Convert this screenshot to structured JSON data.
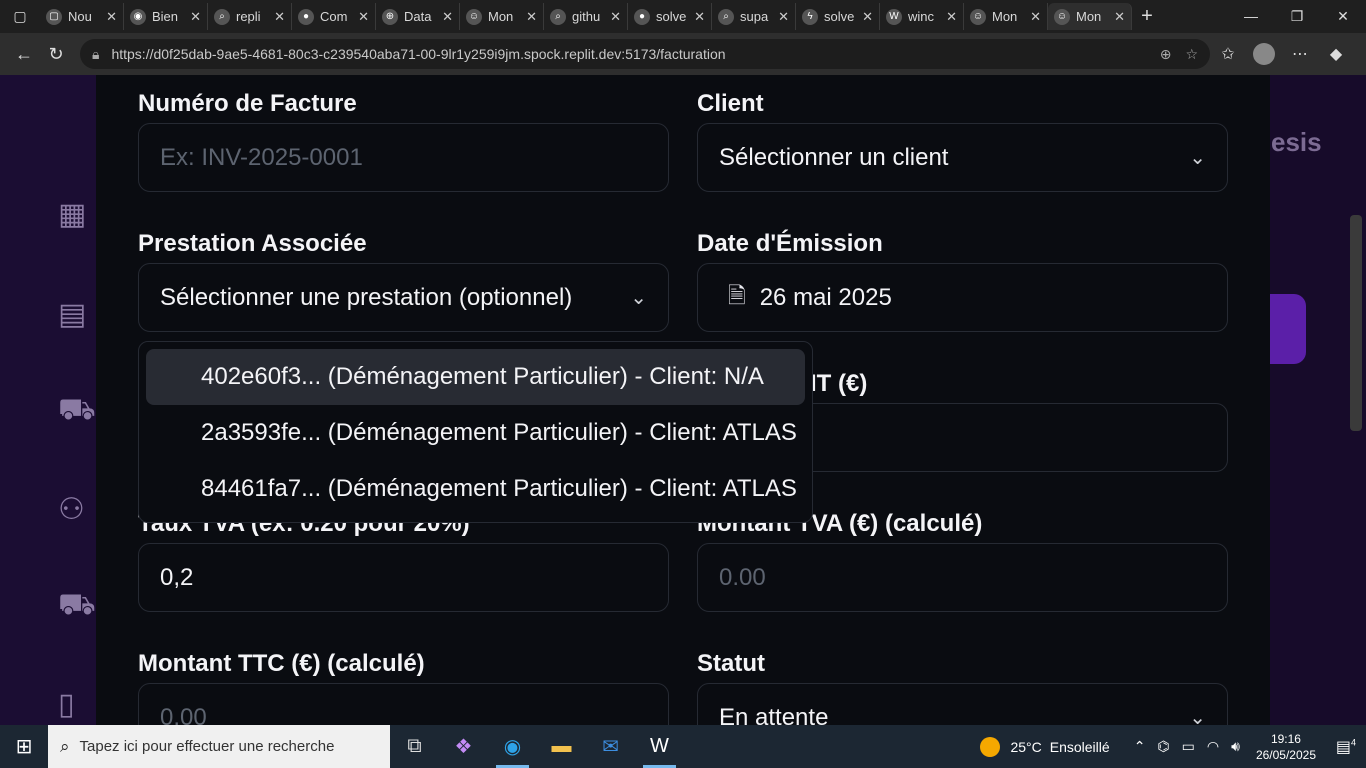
{
  "browser": {
    "tabs": [
      {
        "label": "Nou",
        "icon": "window-icon"
      },
      {
        "label": "Bien",
        "icon": "edge-icon"
      },
      {
        "label": "repli",
        "icon": "search-icon"
      },
      {
        "label": "Com",
        "icon": "github-icon"
      },
      {
        "label": "Data",
        "icon": "globe-icon"
      },
      {
        "label": "Mon",
        "icon": "avatar-icon"
      },
      {
        "label": "githu",
        "icon": "search-icon"
      },
      {
        "label": "solve",
        "icon": "github-icon"
      },
      {
        "label": "supa",
        "icon": "search-icon"
      },
      {
        "label": "solve",
        "icon": "bolt-icon"
      },
      {
        "label": "winc",
        "icon": "windsurf-icon"
      },
      {
        "label": "Mon",
        "icon": "avatar-icon"
      },
      {
        "label": "Mon",
        "icon": "avatar-icon",
        "active": true
      }
    ],
    "url": "https://d0f25dab-9ae5-4681-80c3-c239540aba71-00-9lr1y259i9jm.spock.replit.dev:5173/facturation"
  },
  "background": {
    "right_text": "esis"
  },
  "form": {
    "invoice_number": {
      "label": "Numéro de Facture",
      "placeholder": "Ex: INV-2025-0001"
    },
    "client": {
      "label": "Client",
      "value": "Sélectionner un client"
    },
    "prestation": {
      "label": "Prestation Associée",
      "value": "Sélectionner une prestation (optionnel)"
    },
    "issue_date": {
      "label": "Date d'Émission",
      "value": "26 mai 2025"
    },
    "amount_ht": {
      "label_visible": "IT (€)"
    },
    "vat_rate": {
      "label": "Taux TVA (ex: 0.20 pour 20%)",
      "value": "0,2"
    },
    "vat_amount": {
      "label": "Montant TVA (€) (calculé)",
      "placeholder": "0.00"
    },
    "amount_ttc": {
      "label": "Montant TTC (€) (calculé)",
      "placeholder": "0.00"
    },
    "status": {
      "label": "Statut",
      "value": "En attente"
    }
  },
  "dropdown": {
    "options": [
      {
        "label": "402e60f3... (Déménagement Particulier) - Client: N/A",
        "highlighted": true
      },
      {
        "label": "2a3593fe... (Déménagement Particulier) - Client: ATLAS"
      },
      {
        "label": "84461fa7... (Déménagement Particulier) - Client: ATLAS"
      }
    ]
  },
  "taskbar": {
    "search_placeholder": "Tapez ici pour effectuer une recherche",
    "weather_temp": "25°C",
    "weather_text": "Ensoleillé",
    "time": "19:16",
    "date": "26/05/2025",
    "notification_count": "4"
  },
  "colors": {
    "modal_bg": "#0a0c11",
    "sidebar_bg": "#1b0d33",
    "accent_purple": "#5b1fa8",
    "highlight": "#282b33"
  }
}
